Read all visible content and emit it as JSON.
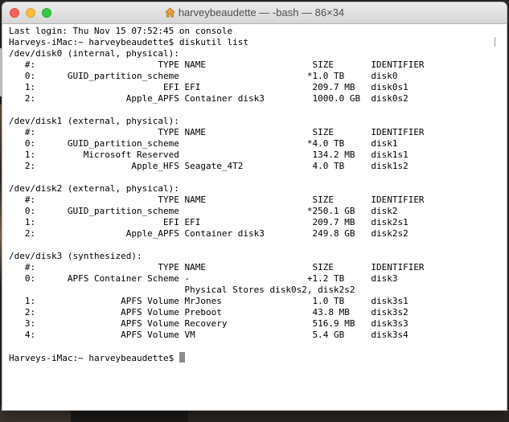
{
  "window": {
    "title": "harveybeaudette — -bash — 86×34",
    "title_icon": "home-icon",
    "colors": {
      "close": "#fc605c",
      "minimize": "#fdbc40",
      "maximize": "#34c84a"
    }
  },
  "terminal": {
    "lines": [
      "Last login: Thu Nov 15 07:52:45 on console",
      "Harveys-iMac:~ harveybeaudette$ diskutil list",
      "/dev/disk0 (internal, physical):",
      "   #:                       TYPE NAME                    SIZE       IDENTIFIER",
      "   0:      GUID_partition_scheme                        *1.0 TB     disk0",
      "   1:                        EFI EFI                     209.7 MB   disk0s1",
      "   2:                 Apple_APFS Container disk3         1000.0 GB  disk0s2",
      "",
      "/dev/disk1 (external, physical):",
      "   #:                       TYPE NAME                    SIZE       IDENTIFIER",
      "   0:      GUID_partition_scheme                        *4.0 TB     disk1",
      "   1:         Microsoft Reserved                         134.2 MB   disk1s1",
      "   2:                  Apple_HFS Seagate_4T2             4.0 TB     disk1s2",
      "",
      "/dev/disk2 (external, physical):",
      "   #:                       TYPE NAME                    SIZE       IDENTIFIER",
      "   0:      GUID_partition_scheme                        *250.1 GB   disk2",
      "   1:                        EFI EFI                     209.7 MB   disk2s1",
      "   2:                 Apple_APFS Container disk3         249.8 GB   disk2s2",
      "",
      "/dev/disk3 (synthesized):",
      "   #:                       TYPE NAME                    SIZE       IDENTIFIER",
      "   0:      APFS Container Scheme -                      +1.2 TB     disk3",
      "                                 Physical Stores disk0s2, disk2s2",
      "   1:                APFS Volume MrJones                 1.0 TB     disk3s1",
      "   2:                APFS Volume Preboot                 43.8 MB    disk3s2",
      "   3:                APFS Volume Recovery                516.9 MB   disk3s3",
      "   4:                APFS Volume VM                      5.4 GB     disk3s4",
      ""
    ],
    "prompt": "Harveys-iMac:~ harveybeaudette$ "
  }
}
